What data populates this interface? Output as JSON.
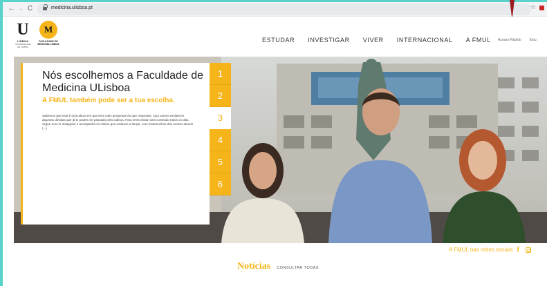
{
  "browser": {
    "url": "medicina.ulisboa.pt",
    "back_icon": "←",
    "forward_icon": "→",
    "reload_icon": "C",
    "star_icon": "☆"
  },
  "header": {
    "ulisboa_logo": {
      "letter": "U",
      "name": "LISBOA",
      "sub": "UNIVERSIDADE DE LISBOA"
    },
    "fmul_logo": {
      "mark": "M",
      "text": "FACULDADE DE MEDICINA LISBOA"
    },
    "nav": [
      "ESTUDAR",
      "INVESTIGAR",
      "VIVER",
      "INTERNACIONAL",
      "A FMUL"
    ],
    "util_nav": [
      "Acesso Rápido",
      "Estu"
    ]
  },
  "hero": {
    "title": "Nós escolhemos a Faculdade de Medicina ULisboa",
    "subtitle": "A FMUL também pode ser a tua escolha.",
    "body": "Sabemos que esta é uma altura em que tens mais perguntas do que respostas. Aqui vamos esclarecer algumas dúvidas que já te podem ter passado pela cabeça. Para teres ainda mais conteúdo todos os dias, segue-nos no Instagram e acompanha os vídeos que estamos a lançar, com testemunhos dos nossos alunos (...)",
    "slides": [
      "1",
      "2",
      "3",
      "4",
      "5",
      "6"
    ],
    "active_slide": 3
  },
  "social": {
    "label": "A FMUL nas redes sociais",
    "facebook_glyph": "f"
  },
  "news": {
    "title": "Notícias",
    "link": "CONSULTAR TODAS"
  },
  "colors": {
    "accent": "#f5b51a",
    "frame": "#5ad2cc"
  }
}
